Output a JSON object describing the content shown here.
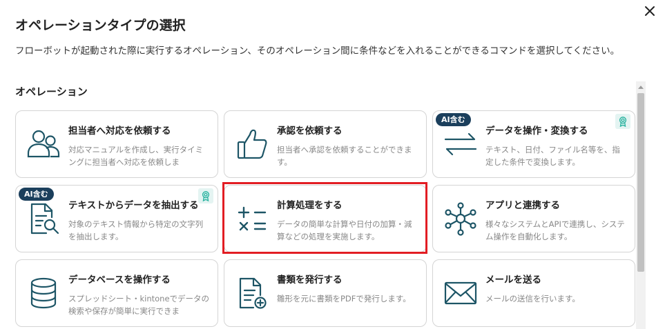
{
  "dialog": {
    "title": "オペレーションタイプの選択",
    "subtitle": "フローボットが起動された際に実行するオペレーション、そのオペレーション間に条件などを入れることができるコマンドを選択してください。",
    "section_heading": "オペレーション"
  },
  "colors": {
    "icon_stroke": "#1d5566",
    "highlight": "#e21d23",
    "badge_bg": "#1b3f5c",
    "award": "#2bb3a0"
  },
  "cards": [
    {
      "title": "担当者へ対応を依頼する",
      "desc": "対応マニュアルを作成し、実行タイミングに担当者へ対応を依頼しま",
      "icon": "people-icon"
    },
    {
      "title": "承認を依頼する",
      "desc": "担当者へ承認を依頼することができます。",
      "icon": "thumbs-up-icon"
    },
    {
      "title": "データを操作・変換する",
      "desc": "テキスト、日付、ファイル名等を、指定した条件で変換します。",
      "icon": "swap-arrows-icon",
      "badge": "AI含む",
      "award": true
    },
    {
      "title": "テキストからデータを抽出する",
      "desc": "対象のテキスト情報から特定の文字列を抽出します。",
      "icon": "document-search-icon",
      "badge": "AI含む",
      "award": true
    },
    {
      "title": "計算処理をする",
      "desc": "データの簡単な計算や日付の加算・減算などの処理を実施します。",
      "icon": "calculator-symbols-icon",
      "selected": true
    },
    {
      "title": "アプリと連携する",
      "desc": "様々なシステムとAPIで連携し、システム操作を自動化します。",
      "icon": "network-hub-icon"
    },
    {
      "title": "データベースを操作する",
      "desc": "スプレッドシート・kintoneでデータの検索や保存が簡単に実行できま",
      "icon": "database-icon"
    },
    {
      "title": "書類を発行する",
      "desc": "雛形を元に書類をPDFで発行します。",
      "icon": "document-add-icon"
    },
    {
      "title": "メールを送る",
      "desc": "メールの送信を行います。",
      "icon": "envelope-icon"
    }
  ]
}
